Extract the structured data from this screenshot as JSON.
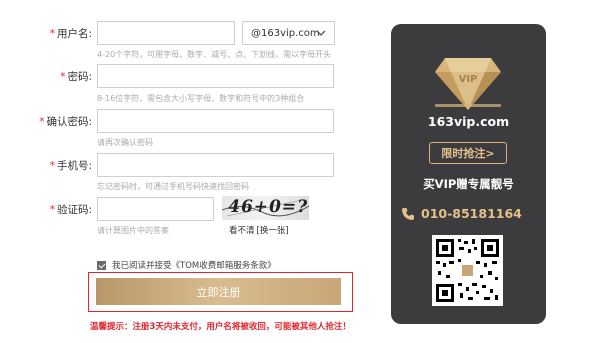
{
  "form": {
    "username": {
      "label": "用户名:",
      "required_mark": "*",
      "value": "",
      "domain": "@163vip.com",
      "hint": "4-20个字符，可用字母、数字、减号、点、下划线，需以字母开头"
    },
    "password": {
      "label": "密码:",
      "required_mark": "*",
      "value": "",
      "hint": "8-16位字符，需包含大小写字母、数字和符号中的3种组合"
    },
    "confirm_password": {
      "label": "确认密码:",
      "required_mark": "*",
      "value": "",
      "hint": "请再次确认密码"
    },
    "phone": {
      "label": "手机号:",
      "required_mark": "*",
      "value": "",
      "hint": "忘记密码时，可通过手机号码快速找回密码"
    },
    "captcha": {
      "label": "验证码:",
      "required_mark": "*",
      "value": "",
      "hint": "请计算图片中的答案",
      "image_text": "46+0=?",
      "unclear": "看不清",
      "refresh": "[换一张]"
    },
    "agreement": {
      "checked": true,
      "text": "我已阅读并接受",
      "link": "《TOM收费邮箱服务条款》"
    },
    "submit_label": "立即注册",
    "warning": "温馨提示：注册3天内未支付，用户名将被收回，可能被其他人抢注！"
  },
  "vip": {
    "domain": "163vip.com",
    "badge": "限时抢注>",
    "slogan": "买VIP赠专属靓号",
    "phone": "010-85181164",
    "logo_text": "VIP"
  },
  "colors": {
    "required": "#e0262e",
    "gold": "#d9b27a",
    "card_bg": "#3c3c3e",
    "button": "#c9a678"
  }
}
